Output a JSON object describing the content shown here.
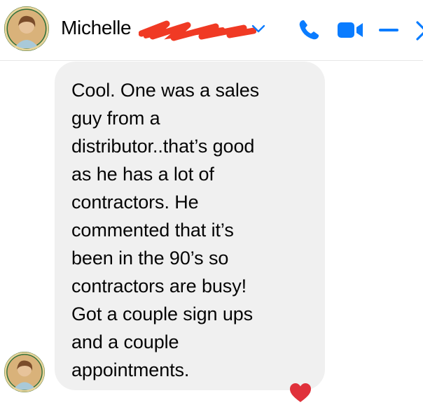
{
  "header": {
    "contact_name": "Michelle",
    "icons": {
      "avatar": "profile-avatar",
      "chevron": "chevron-down-icon",
      "call": "phone-icon",
      "video": "video-camera-icon",
      "minimize": "minimize-icon",
      "close": "close-icon"
    }
  },
  "message": {
    "text": "Cool. One was a sales\nguy from a\ndistributor..that’s good\nas he has a lot of\ncontractors. He\ncommented that it’s\nbeen in the 90’s so\ncontractors are busy!\nGot a couple sign ups\nand a couple\nappointments.",
    "reaction": "heart-reaction-icon"
  },
  "colors": {
    "accent": "#0a7cff",
    "bubble": "#f0f0f0",
    "text": "#050505",
    "redaction": "#f03a24",
    "heart": "#e0313b"
  }
}
